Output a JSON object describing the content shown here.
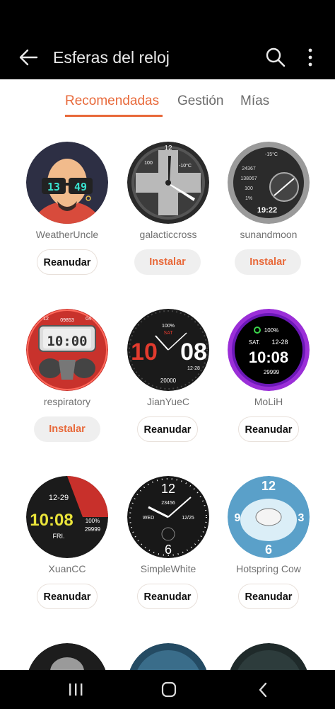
{
  "header": {
    "title": "Esferas del reloj"
  },
  "tabs": [
    {
      "label": "Recomendadas",
      "active": true
    },
    {
      "label": "Gestión",
      "active": false
    },
    {
      "label": "Mías",
      "active": false
    }
  ],
  "faces": [
    {
      "name": "WeatherUncle",
      "action": "Reanudar",
      "type": "resume",
      "glasses_time": [
        "13",
        "49"
      ]
    },
    {
      "name": "galacticcross",
      "action": "Instalar",
      "type": "install",
      "display": {
        "top": "12",
        "temp": "-10°C",
        "num": "100"
      }
    },
    {
      "name": "sunandmoon",
      "action": "Instalar",
      "type": "install",
      "display": {
        "temp": "-15°C",
        "val1": "24367",
        "val2": "138067",
        "val3": "100",
        "val4": "1%",
        "time": "19:22"
      }
    },
    {
      "name": "respiratory",
      "action": "Instalar",
      "type": "install",
      "display": {
        "num": "09853",
        "time": "10:00",
        "left": "12",
        "right": "04"
      }
    },
    {
      "name": "JianYueC",
      "action": "Reanudar",
      "type": "resume",
      "display": {
        "pct": "100%",
        "day": "SAT",
        "hour": "10",
        "min": "08",
        "date": "12-28",
        "steps": "20000"
      }
    },
    {
      "name": "MoLiH",
      "action": "Reanudar",
      "type": "resume",
      "display": {
        "pct": "100%",
        "day": "SAT.",
        "date": "12-28",
        "time": "10:08",
        "steps": "29999"
      }
    },
    {
      "name": "XuanCC",
      "action": "Reanudar",
      "type": "resume",
      "display": {
        "date": "12-29",
        "time": "10:08",
        "day": "FRI.",
        "pct": "100%",
        "steps": "29999"
      }
    },
    {
      "name": "SimpleWhite",
      "action": "Reanudar",
      "type": "resume",
      "display": {
        "num": "23456",
        "day": "WED",
        "date": "12/25",
        "top": "12",
        "bottom": "6"
      }
    },
    {
      "name": "Hotspring Cow",
      "action": "Reanudar",
      "type": "resume",
      "display": {
        "top": "12",
        "left": "9",
        "right": "3",
        "bottom": "6"
      }
    }
  ],
  "colors": {
    "accent": "#e8693a",
    "bar": "#000000"
  }
}
